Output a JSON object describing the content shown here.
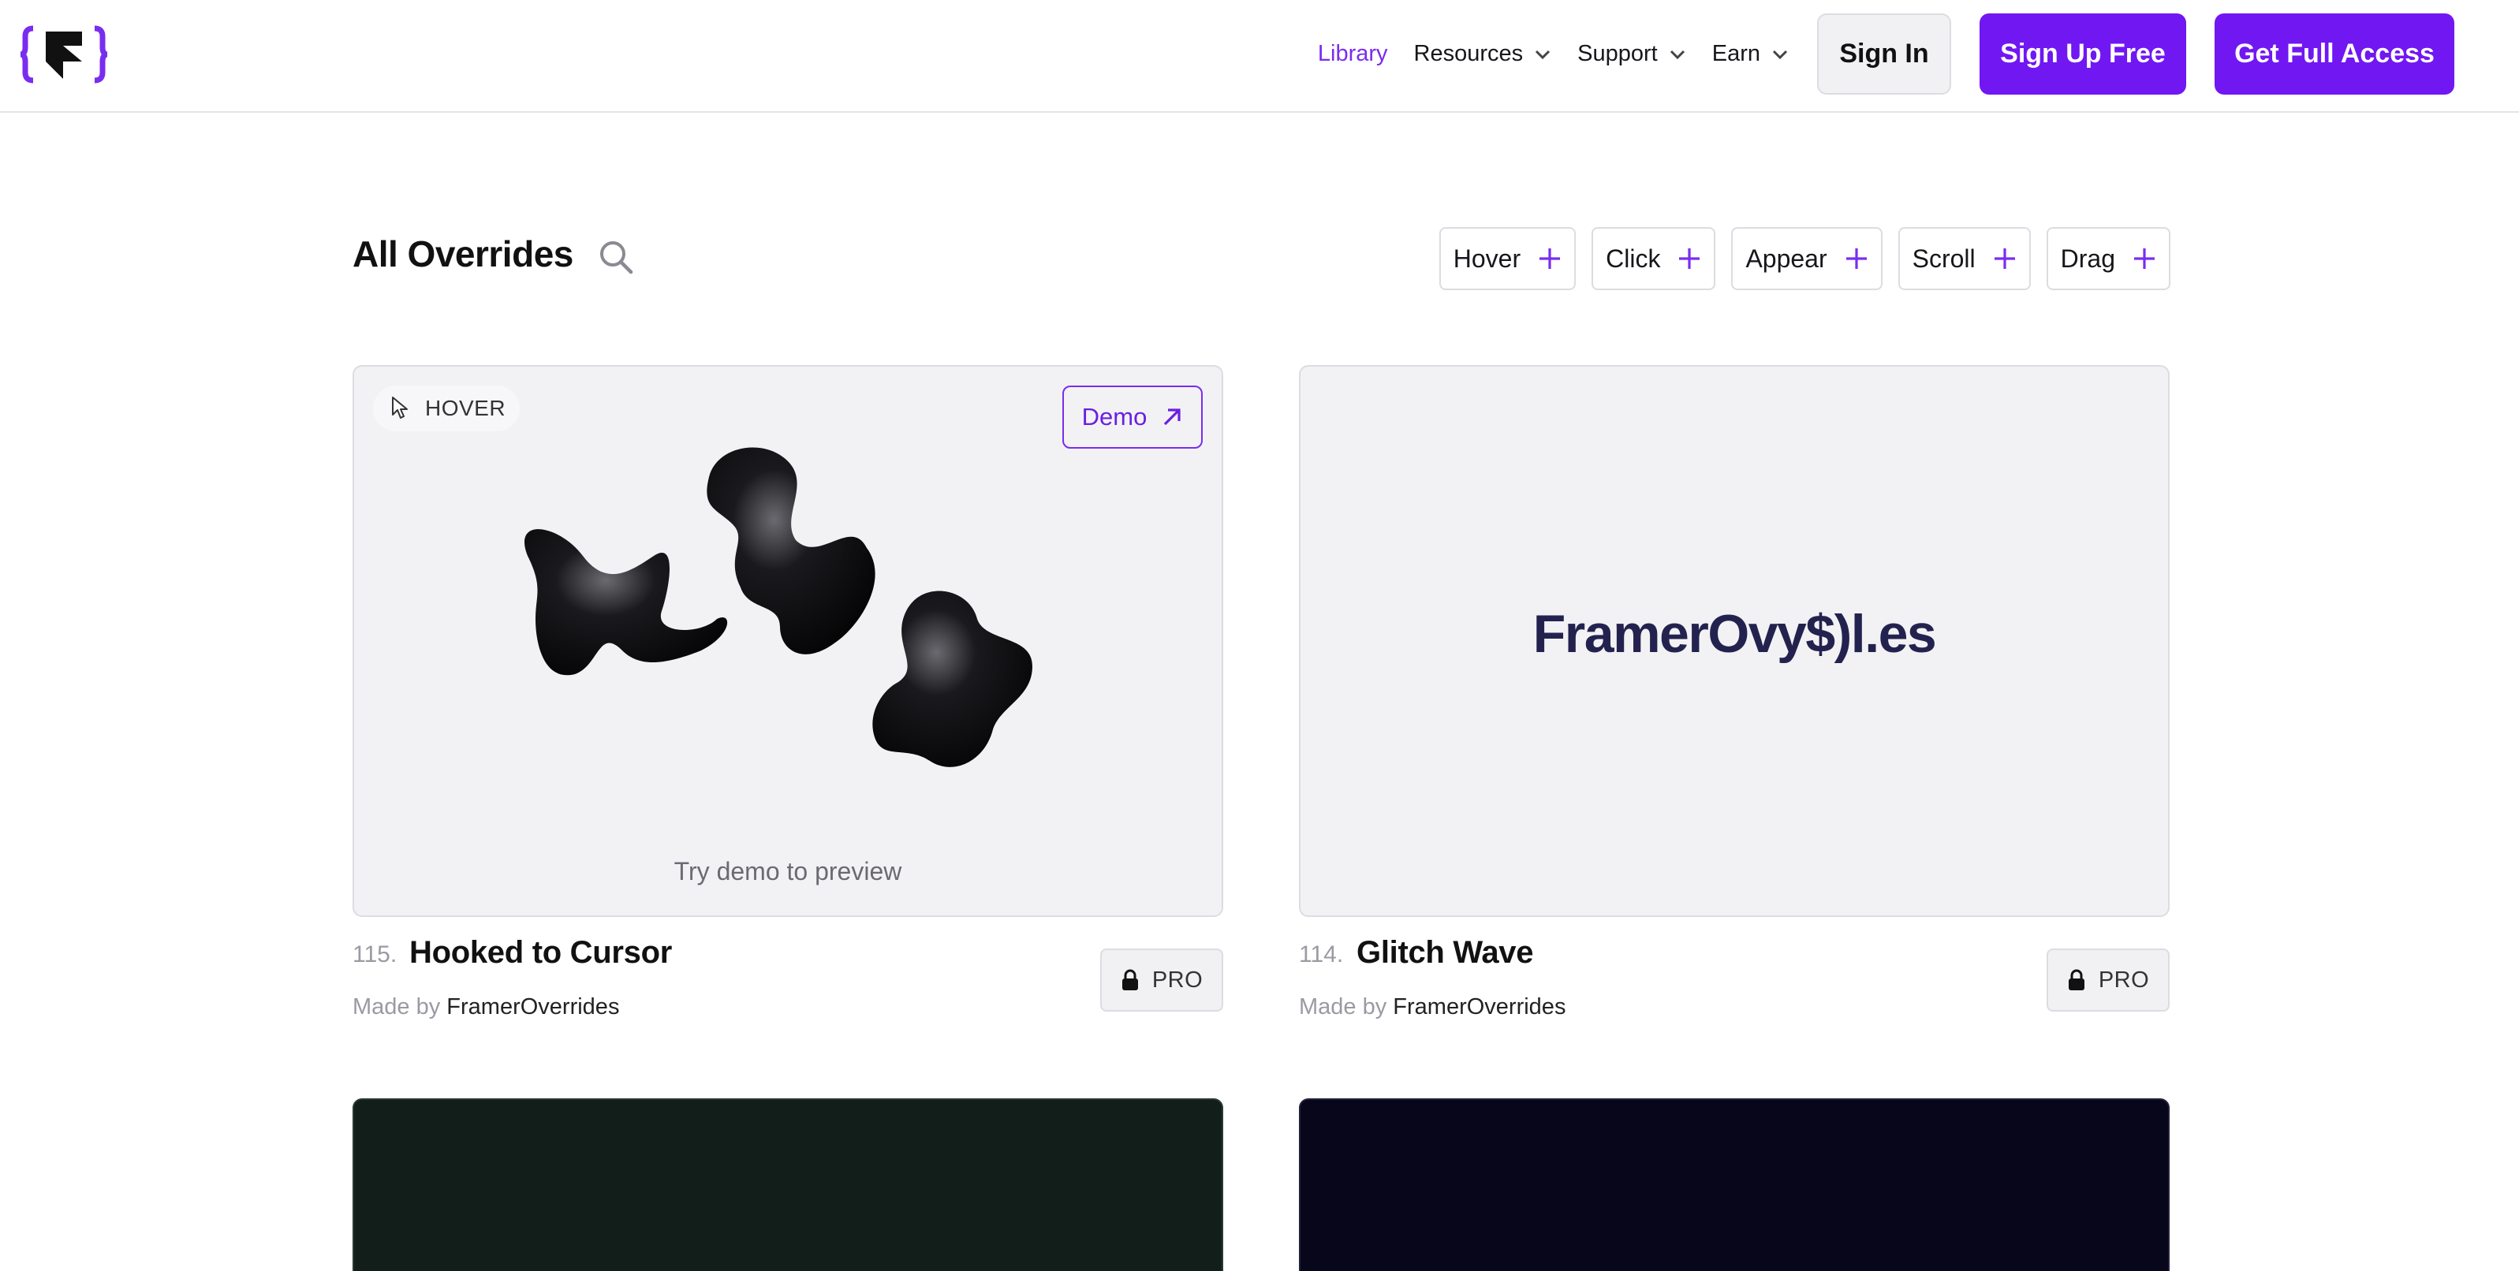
{
  "nav": {
    "logo_icon": "framer-overrides-logo-icon",
    "library": "Library",
    "resources": "Resources",
    "support": "Support",
    "earn": "Earn",
    "sign_in": "Sign In",
    "sign_up": "Sign Up Free",
    "full_access": "Get Full Access"
  },
  "section": {
    "title": "All Overrides",
    "search_icon": "search-icon"
  },
  "filters": [
    "Hover",
    "Click",
    "Appear",
    "Scroll",
    "Drag"
  ],
  "cards": [
    {
      "tag": "HOVER",
      "demo_label": "Demo",
      "preview_text": "Try demo to preview",
      "number": "115.",
      "title": "Hooked to Cursor",
      "made_by": "Made by",
      "author": "FramerOverrides",
      "pro_label": "PRO"
    },
    {
      "preview_text": "FramerOvy$)l.es",
      "number": "114.",
      "title": "Glitch Wave",
      "made_by": "Made by",
      "author": "FramerOverrides",
      "pro_label": "PRO"
    }
  ],
  "colors": {
    "accent": "#7117f2",
    "accent_text": "#7a2cf0",
    "card_bg": "#f2f2f4",
    "card3_bg": "#111e1a",
    "card4_bg": "#07061a",
    "glitch_text": "#23224f"
  }
}
